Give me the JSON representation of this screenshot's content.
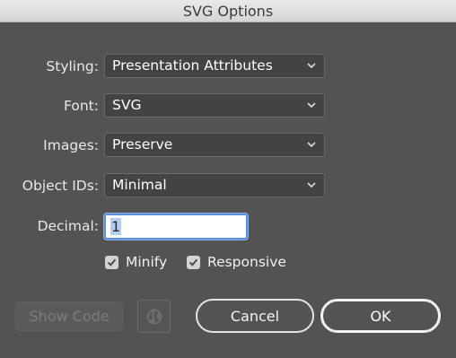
{
  "window": {
    "title": "SVG Options"
  },
  "fields": {
    "styling": {
      "label": "Styling:",
      "value": "Presentation Attributes"
    },
    "font": {
      "label": "Font:",
      "value": "SVG"
    },
    "images": {
      "label": "Images:",
      "value": "Preserve"
    },
    "object_ids": {
      "label": "Object IDs:",
      "value": "Minimal"
    },
    "decimal": {
      "label": "Decimal:",
      "value": "1"
    }
  },
  "checkboxes": {
    "minify": {
      "label": "Minify",
      "checked": true
    },
    "responsive": {
      "label": "Responsive",
      "checked": true
    }
  },
  "buttons": {
    "show_code": "Show Code",
    "globe_icon": "globe-icon",
    "cancel": "Cancel",
    "ok": "OK"
  },
  "colors": {
    "dialog_bg": "#535353",
    "field_bg": "#434343",
    "focus_ring": "#5d8fd8",
    "selection": "#b4cdf0"
  }
}
